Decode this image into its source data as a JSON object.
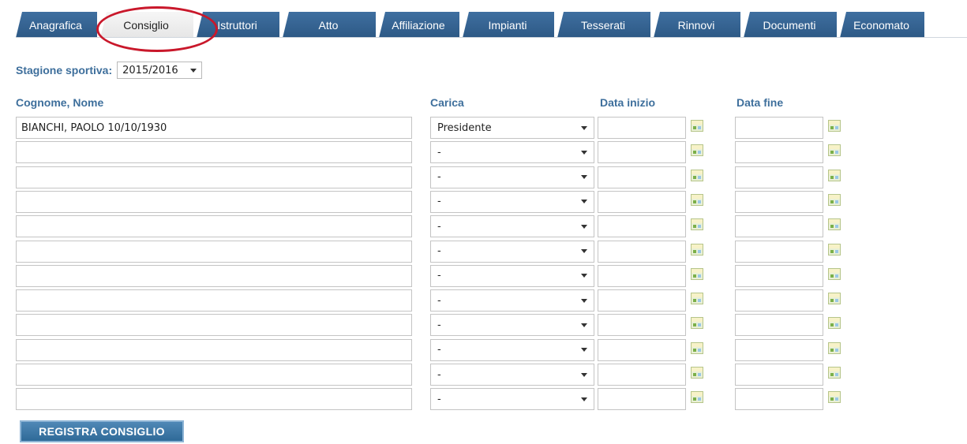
{
  "tabs": [
    {
      "label": "Anagrafica",
      "active": false
    },
    {
      "label": "Consiglio",
      "active": true
    },
    {
      "label": "Istruttori",
      "active": false
    },
    {
      "label": "Atto",
      "active": false
    },
    {
      "label": "Affiliazione",
      "active": false
    },
    {
      "label": "Impianti",
      "active": false
    },
    {
      "label": "Tesserati",
      "active": false
    },
    {
      "label": "Rinnovi",
      "active": false
    },
    {
      "label": "Documenti",
      "active": false
    },
    {
      "label": "Economato",
      "active": false
    }
  ],
  "season": {
    "label": "Stagione sportiva:",
    "value": "2015/2016"
  },
  "columns": {
    "name": "Cognome, Nome",
    "role": "Carica",
    "start": "Data inizio",
    "end": "Data fine"
  },
  "rows": [
    {
      "name": "BIANCHI, PAOLO 10/10/1930",
      "role": "Presidente",
      "start": "",
      "end": ""
    },
    {
      "name": "",
      "role": "-",
      "start": "",
      "end": ""
    },
    {
      "name": "",
      "role": "-",
      "start": "",
      "end": ""
    },
    {
      "name": "",
      "role": "-",
      "start": "",
      "end": ""
    },
    {
      "name": "",
      "role": "-",
      "start": "",
      "end": ""
    },
    {
      "name": "",
      "role": "-",
      "start": "",
      "end": ""
    },
    {
      "name": "",
      "role": "-",
      "start": "",
      "end": ""
    },
    {
      "name": "",
      "role": "-",
      "start": "",
      "end": ""
    },
    {
      "name": "",
      "role": "-",
      "start": "",
      "end": ""
    },
    {
      "name": "",
      "role": "-",
      "start": "",
      "end": ""
    },
    {
      "name": "",
      "role": "-",
      "start": "",
      "end": ""
    },
    {
      "name": "",
      "role": "-",
      "start": "",
      "end": ""
    }
  ],
  "save_button": "REGISTRA CONSIGLIO",
  "icons": {
    "calendar": "calendar-icon",
    "dropdown": "chevron-down-icon"
  },
  "colors": {
    "tab": "#2d5985",
    "label": "#3e6f9c",
    "annotation": "#c9182b",
    "button": "#2f6a98"
  }
}
